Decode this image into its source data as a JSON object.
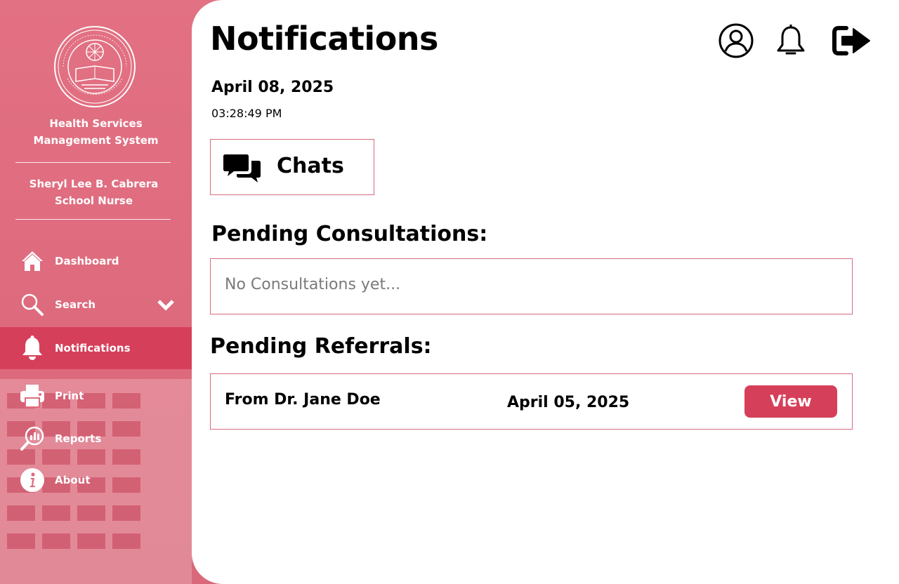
{
  "sidebar": {
    "app_name_line1": "Health Services",
    "app_name_line2": "Management System",
    "user_name": "Sheryl Lee B. Cabrera",
    "user_role": "School Nurse",
    "items": [
      {
        "label": "Dashboard",
        "icon": "home-icon"
      },
      {
        "label": "Search",
        "icon": "search-icon"
      },
      {
        "label": "Notifications",
        "icon": "bell-icon"
      },
      {
        "label": "Print",
        "icon": "printer-icon"
      },
      {
        "label": "Reports",
        "icon": "reports-icon"
      },
      {
        "label": "About",
        "icon": "info-icon"
      }
    ],
    "active_item": "Notifications"
  },
  "header": {
    "title": "Notifications",
    "icons": [
      "user-profile-icon",
      "bell-icon",
      "logout-icon"
    ]
  },
  "datetime": {
    "date": "April 08, 2025",
    "time": "03:28:49 PM"
  },
  "chats": {
    "label": "Chats",
    "icon": "chat-bubbles-icon"
  },
  "consultations": {
    "title": "Pending Consultations:",
    "empty_text": "No Consultations yet..."
  },
  "referrals": {
    "title": "Pending Referrals:",
    "items": [
      {
        "from": "From Dr. Jane Doe",
        "date": "April 05, 2025",
        "action": "View"
      }
    ]
  },
  "colors": {
    "sidebar_bg": "#de6b7d",
    "accent": "#d63f5a",
    "card_border": "#d96a7d"
  }
}
